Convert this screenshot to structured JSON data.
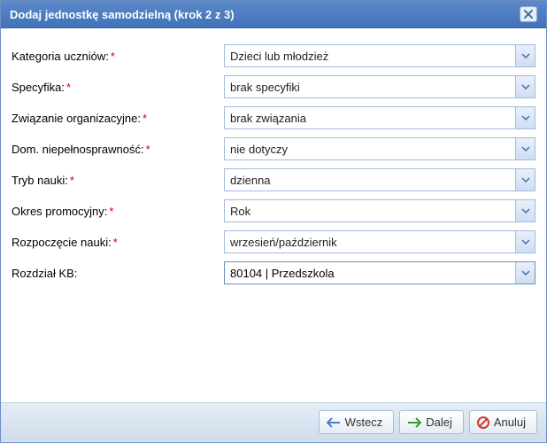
{
  "dialog": {
    "title": "Dodaj jednostkę samodzielną (krok 2 z 3)"
  },
  "form": {
    "rows": [
      {
        "label": "Kategoria uczniów:",
        "required": true,
        "value": "Dzieci lub młodzież",
        "name": "kategoria-uczniow"
      },
      {
        "label": "Specyfika:",
        "required": true,
        "value": "brak specyfiki",
        "name": "specyfika"
      },
      {
        "label": "Związanie organizacyjne:",
        "required": true,
        "value": "brak związania",
        "name": "zwiazanie-organizacyjne"
      },
      {
        "label": "Dom. niepełnosprawność:",
        "required": true,
        "value": "nie dotyczy",
        "name": "dom-niepelnosprawnosc"
      },
      {
        "label": "Tryb nauki:",
        "required": true,
        "value": "dzienna",
        "name": "tryb-nauki"
      },
      {
        "label": "Okres promocyjny:",
        "required": true,
        "value": "Rok",
        "name": "okres-promocyjny"
      },
      {
        "label": "Rozpoczęcie nauki:",
        "required": true,
        "value": "wrzesień/październik",
        "name": "rozpoczecie-nauki"
      }
    ],
    "combo": {
      "label": "Rozdział KB:",
      "required": false,
      "value": "80104 | Przedszkola",
      "name": "rozdzial-kb"
    }
  },
  "buttons": {
    "back": "Wstecz",
    "next": "Dalej",
    "cancel": "Anuluj"
  }
}
